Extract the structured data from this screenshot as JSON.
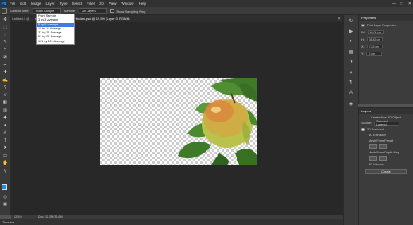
{
  "app": {
    "logo": "Ps"
  },
  "menubar": {
    "items": [
      "File",
      "Edit",
      "Image",
      "Layer",
      "Type",
      "Select",
      "Filter",
      "3D",
      "View",
      "Window",
      "Help"
    ]
  },
  "window_controls": {
    "minimize": "—",
    "maximize": "□",
    "close": "✕"
  },
  "options_bar": {
    "sample_size_label": "Sample Size:",
    "sample_size_value": "Point Sample",
    "sample_label": "Sample:",
    "sample_value": "All Layers",
    "show_ring_label": "Show Sampling Ring"
  },
  "dropdown": {
    "options": [
      "Point Sample",
      "3 by 3 Average",
      "5 by 5 Average",
      "11 by 11 Average",
      "31 by 31 Average",
      "51 by 51 Average",
      "101 by 101 Average"
    ],
    "selected_index": 2
  },
  "document_tab": {
    "prefix": "Untitled-1 @",
    "name": "stock_216890776 crop layerHidden.psd @ 12.5% (Layer 0, RGB/8)",
    "close": "✕"
  },
  "status": {
    "zoom": "12.5%",
    "doc": "Doc: 32.3M/36.6M"
  },
  "timeline": {
    "label": "Timeline"
  },
  "properties": {
    "tab": "Properties",
    "section": "Pixel Layer Properties",
    "w_label": "W:",
    "w_value": "49.08 cm",
    "h_label": "H:",
    "h_value": "36.83 cm",
    "x_label": "X:",
    "x_value": "7.83 cm",
    "y_label": "Y:",
    "y_value": "0 cm"
  },
  "layers_panel": {
    "tab": "Layers",
    "title": "Create New 3D Object",
    "source_label": "Source:",
    "source_value": "Selected Layer(s)",
    "options": [
      "3D Postcard",
      "3D Extrusion",
      "Mesh From Preset",
      "Mesh From Depth Map",
      "3D Volume"
    ],
    "selected_index": 0,
    "create_label": "Create"
  },
  "colors": {
    "foreground": "#1e8fd8",
    "background": "#0a3d5e",
    "accent": "#3b7de0"
  }
}
